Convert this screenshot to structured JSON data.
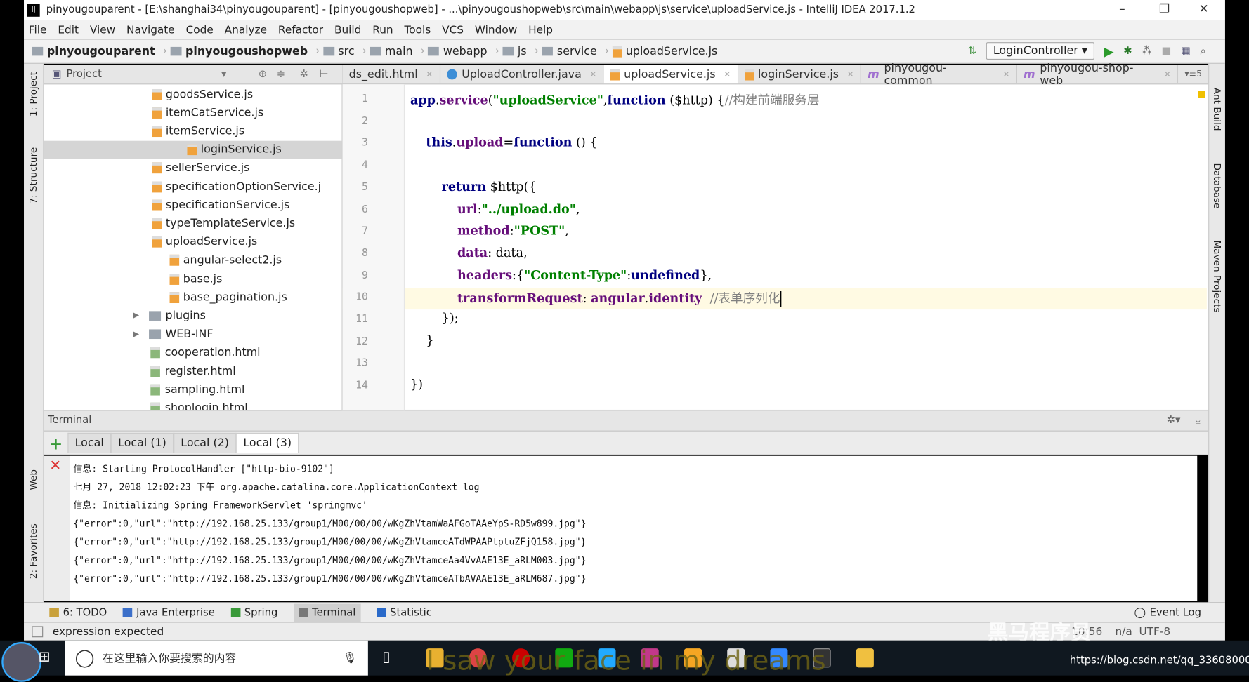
{
  "window": {
    "title": "pinyougouparent - [E:\\shanghai34\\pinyougouparent] - [pinyougoushopweb] - ...\\pinyougoushopweb\\src\\main\\webapp\\js\\service\\uploadService.js - IntelliJ IDEA 2017.1.2"
  },
  "menu": [
    "File",
    "Edit",
    "View",
    "Navigate",
    "Code",
    "Analyze",
    "Refactor",
    "Build",
    "Run",
    "Tools",
    "VCS",
    "Window",
    "Help"
  ],
  "breadcrumbs": [
    "pinyougouparent",
    "pinyougoushopweb",
    "src",
    "main",
    "webapp",
    "js",
    "service",
    "uploadService.js"
  ],
  "run_config": "LoginController",
  "left_strip": [
    "1: Project",
    "7: Structure",
    "Web",
    "2: Favorites"
  ],
  "right_strip": [
    "Ant Build",
    "Database",
    "Maven Projects"
  ],
  "project": {
    "title": "Project",
    "items": [
      {
        "label": "goodsService.js",
        "type": "js",
        "depth": 2
      },
      {
        "label": "itemCatService.js",
        "type": "js",
        "depth": 2
      },
      {
        "label": "itemService.js",
        "type": "js",
        "depth": 2
      },
      {
        "label": "loginService.js",
        "type": "js",
        "depth": 2,
        "selected": true
      },
      {
        "label": "sellerService.js",
        "type": "js",
        "depth": 2
      },
      {
        "label": "specificationOptionService.j",
        "type": "js",
        "depth": 2
      },
      {
        "label": "specificationService.js",
        "type": "js",
        "depth": 2
      },
      {
        "label": "typeTemplateService.js",
        "type": "js",
        "depth": 2
      },
      {
        "label": "uploadService.js",
        "type": "js",
        "depth": 2
      },
      {
        "label": "angular-select2.js",
        "type": "js",
        "depth": 1
      },
      {
        "label": "base.js",
        "type": "js",
        "depth": 1
      },
      {
        "label": "base_pagination.js",
        "type": "js",
        "depth": 1
      },
      {
        "label": "plugins",
        "type": "dir",
        "depth": 0
      },
      {
        "label": "WEB-INF",
        "type": "dir",
        "depth": 0
      },
      {
        "label": "cooperation.html",
        "type": "html",
        "depth": 0
      },
      {
        "label": "register.html",
        "type": "html",
        "depth": 0
      },
      {
        "label": "sampling.html",
        "type": "html",
        "depth": 0
      },
      {
        "label": "shoplogin.html",
        "type": "html",
        "depth": 0
      }
    ]
  },
  "tabs": [
    {
      "label": "ds_edit.html",
      "icon": "html"
    },
    {
      "label": "UploadController.java",
      "icon": "class"
    },
    {
      "label": "uploadService.js",
      "icon": "js",
      "active": true
    },
    {
      "label": "loginService.js",
      "icon": "js"
    },
    {
      "label": "pinyougou-common",
      "icon": "maven"
    },
    {
      "label": "pinyougou-shop-web",
      "icon": "maven"
    }
  ],
  "editor": {
    "current_line": 10,
    "lines": [
      [
        [
          "kw",
          "app"
        ],
        [
          "",
          "."
        ],
        [
          "prop",
          "service"
        ],
        [
          "",
          "("
        ],
        [
          "str",
          "\"uploadService\""
        ],
        [
          "",
          ","
        ],
        [
          "kw",
          "function"
        ],
        [
          "",
          " ($http) {"
        ],
        [
          "cm",
          "//构建前端服务层"
        ]
      ],
      [],
      [
        [
          "",
          "    "
        ],
        [
          "kw",
          "this"
        ],
        [
          "",
          "."
        ],
        [
          "prop",
          "upload"
        ],
        [
          "",
          "="
        ],
        [
          "kw",
          "function"
        ],
        [
          "",
          " () {"
        ]
      ],
      [],
      [
        [
          "",
          "        "
        ],
        [
          "kw",
          "return"
        ],
        [
          "",
          " $http({"
        ]
      ],
      [
        [
          "",
          "            "
        ],
        [
          "prop",
          "url"
        ],
        [
          "",
          ":"
        ],
        [
          "str",
          "\"../upload.do\""
        ],
        [
          "",
          ","
        ]
      ],
      [
        [
          "",
          "            "
        ],
        [
          "prop",
          "method"
        ],
        [
          "",
          ":"
        ],
        [
          "str",
          "\"POST\""
        ],
        [
          "",
          ","
        ]
      ],
      [
        [
          "",
          "            "
        ],
        [
          "prop",
          "data"
        ],
        [
          "",
          ": data,"
        ]
      ],
      [
        [
          "",
          "            "
        ],
        [
          "prop",
          "headers"
        ],
        [
          "",
          ":{"
        ],
        [
          "str",
          "\"Content-Type\""
        ],
        [
          "",
          ":"
        ],
        [
          "kw",
          "undefined"
        ],
        [
          "",
          "},"
        ]
      ],
      [
        [
          "",
          "            "
        ],
        [
          "prop",
          "transformRequest"
        ],
        [
          "",
          ": "
        ],
        [
          "prop",
          "angular"
        ],
        [
          "",
          "."
        ],
        [
          "prop",
          "identity"
        ],
        [
          "",
          "  "
        ],
        [
          "cm",
          "//表单序列化"
        ]
      ],
      [
        [
          "",
          "        "
        ],
        [
          "",
          "});"
        ]
      ],
      [
        [
          "",
          "    "
        ],
        [
          "",
          "}"
        ]
      ],
      [],
      [
        [
          "",
          "})"
        ]
      ]
    ]
  },
  "terminal": {
    "title": "Terminal",
    "tabs": [
      "Local",
      "Local (1)",
      "Local (2)",
      "Local (3)"
    ],
    "active_tab": 3,
    "lines": [
      "信息: Starting ProtocolHandler [\"http-bio-9102\"]",
      "七月 27, 2018 12:02:23 下午 org.apache.catalina.core.ApplicationContext log",
      "信息: Initializing Spring FrameworkServlet 'springmvc'",
      "{\"error\":0,\"url\":\"http://192.168.25.133/group1/M00/00/00/wKgZhVtamWaAFGoTAAeYpS-RD5w899.jpg\"}",
      "{\"error\":0,\"url\":\"http://192.168.25.133/group1/M00/00/00/wKgZhVtamceATdWPAAPtptuZFjQ158.jpg\"}",
      "{\"error\":0,\"url\":\"http://192.168.25.133/group1/M00/00/00/wKgZhVtamceAa4VvAAE13E_aRLM003.jpg\"}",
      "{\"error\":0,\"url\":\"http://192.168.25.133/group1/M00/00/00/wKgZhVtamceATbAVAAE13E_aRLM687.jpg\"}"
    ]
  },
  "tool_windows": [
    "6: TODO",
    "Java Enterprise",
    "Spring",
    "Terminal",
    "Statistic"
  ],
  "event_log": "Event Log",
  "status": {
    "message": "expression expected",
    "position": "10:56",
    "line_sep": "n/a",
    "encoding": "UTF-8"
  },
  "taskbar": {
    "search_placeholder": "在这里输入你要搜索的内容",
    "overlay_text": "I saw your face in my dreams",
    "watermark": "黑马程序员",
    "url": "https://blog.csdn.net/qq_33608000"
  }
}
